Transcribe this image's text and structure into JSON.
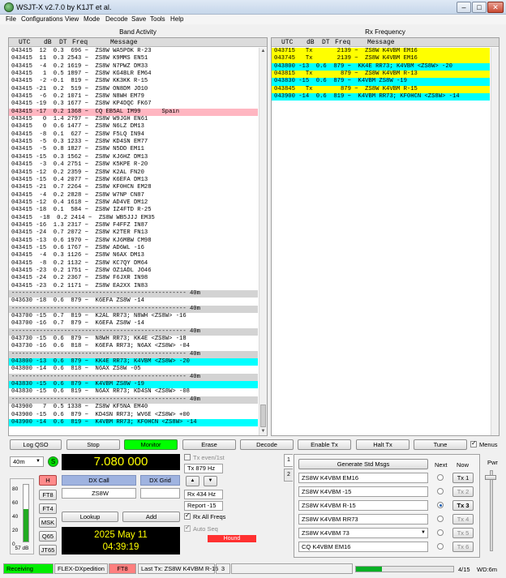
{
  "title": "WSJT-X   v2.7.0   by K1JT et al.",
  "menu": [
    "File",
    "Configurations",
    "View",
    "Mode",
    "Decode",
    "Save",
    "Tools",
    "Help"
  ],
  "band_activity": {
    "title": "Band Activity",
    "headers": [
      "UTC",
      "dB",
      "DT",
      "Freq",
      "Message"
    ],
    "lines": [
      {
        "t": "043415  12  0.3  696 ~  ZS8W WA5POK R-23",
        "c": ""
      },
      {
        "t": "043415  11  0.3 2543 ~  ZS8W K9MMS EN51",
        "c": ""
      },
      {
        "t": "043415  -4  0.2 1619 ~  ZS8W N7PWZ DM33",
        "c": ""
      },
      {
        "t": "043415   1  0.5 1897 ~  ZS8W KG4BLR EM64",
        "c": ""
      },
      {
        "t": "043415  -2 -0.1  819 ~  ZS8W KK3KK R-15",
        "c": ""
      },
      {
        "t": "043415 -21  0.2  519 ~  ZS8W ON8DM JO10",
        "c": ""
      },
      {
        "t": "043415  -6  0.2 1071 ~  ZS8W N8WH EM79",
        "c": ""
      },
      {
        "t": "043415 -19  0.3 1677 ~  ZS8W KP4DQC FK67",
        "c": ""
      },
      {
        "t": "043415 -17  0.2 1368 ~  CQ EB5AL IM99      Spain",
        "c": "pink"
      },
      {
        "t": "043415   0  1.4 2797 ~  ZS8W W9JGH EN61",
        "c": ""
      },
      {
        "t": "043415   0  0.6 1477 ~  ZS8W N6LZ DM13",
        "c": ""
      },
      {
        "t": "043415  -8  0.1  627 ~  ZS8W F5LQ IN94",
        "c": ""
      },
      {
        "t": "043415  -5  0.3 1233 ~  ZS8W KD4SN EM77",
        "c": ""
      },
      {
        "t": "043415  -5  0.8 1827 ~  ZS8W N5DD EM11",
        "c": ""
      },
      {
        "t": "043415 -15  0.3 1562 ~  ZS8W KJ6HZ DM13",
        "c": ""
      },
      {
        "t": "043415  -3  0.4 2751 ~  ZS8W K5KPE R-20",
        "c": ""
      },
      {
        "t": "043415 -12  0.2 2359 ~  ZS8W K2AL FN20",
        "c": ""
      },
      {
        "t": "043415 -15  0.4 2077 ~  ZS8W K6EFA DM13",
        "c": ""
      },
      {
        "t": "043415 -21  0.7 2264 ~  ZS8W KF0HCN EM28",
        "c": ""
      },
      {
        "t": "043415  -4  0.2 2828 ~  ZS8W W7NP CN87",
        "c": ""
      },
      {
        "t": "043415 -12  0.4 1618 ~  ZS8W AD4VE DM12",
        "c": ""
      },
      {
        "t": "043415 -18  0.1  584 ~  ZS8W IZ4FTD R-25",
        "c": ""
      },
      {
        "t": "043415  -18  0.2 2414 ~  ZS8W WB5JJJ EM35",
        "c": ""
      },
      {
        "t": "043415 -16  1.3 2317 ~  ZS8W F4FFZ IN87",
        "c": ""
      },
      {
        "t": "043415 -24  0.7 2072 ~  ZS8W K2TER FN13",
        "c": ""
      },
      {
        "t": "043415 -13  0.6 1970 ~  ZS8W KJ6MBW CM98",
        "c": ""
      },
      {
        "t": "043415 -15  0.6 1767 ~  ZS8W AD6WL -16",
        "c": ""
      },
      {
        "t": "043415  -4  0.3 1126 ~  ZS8W N6AX DM13",
        "c": ""
      },
      {
        "t": "043415  -8  0.2 1132 ~  ZS8W KC7QY DM64",
        "c": ""
      },
      {
        "t": "043415 -23  0.2 1751 ~  ZS8W OZ1ADL JO46",
        "c": ""
      },
      {
        "t": "043415 -24  0.2 2367 ~  ZS8W F6JXR IN98",
        "c": ""
      },
      {
        "t": "043415 -23  0.2 1171 ~  ZS8W EA2XX IN83",
        "c": ""
      },
      {
        "t": "-------------------------------------------------- 40m",
        "c": "sep"
      },
      {
        "t": "043630 -18  0.6  879 ~  K6EFA ZS8W -14",
        "c": ""
      },
      {
        "t": "-------------------------------------------------- 40m",
        "c": "sep"
      },
      {
        "t": "043700 -15  0.7  819 ~  K2AL RR73; N8WH <ZS8W> -16",
        "c": ""
      },
      {
        "t": "043700 -16  0.7  879 ~  K6EFA ZS8W -14",
        "c": ""
      },
      {
        "t": "-------------------------------------------------- 40m",
        "c": "sep"
      },
      {
        "t": "043730 -15  0.6  879 ~  N8WH RR73; KK4E <ZS8W> -18",
        "c": ""
      },
      {
        "t": "043730 -16  0.6  818 ~  K6EFA RR73; N6AX <ZS8W> -04",
        "c": ""
      },
      {
        "t": "-------------------------------------------------- 40m",
        "c": "sep"
      },
      {
        "t": "043800 -13  0.6  879 ~  KK4E RR73; K4VBM <ZS8W> -20",
        "c": "cyan"
      },
      {
        "t": "043800 -14  0.6  818 ~  N6AX ZS8W -05",
        "c": ""
      },
      {
        "t": "-------------------------------------------------- 40m",
        "c": "sep"
      },
      {
        "t": "043830 -15  0.6  879 ~  K4VBM ZS8W -19",
        "c": "cyan"
      },
      {
        "t": "043830 -15  0.6  819 ~  N6AX RR73; KD4SN <ZS8W> -08",
        "c": ""
      },
      {
        "t": "-------------------------------------------------- 40m",
        "c": "sep"
      },
      {
        "t": "043900   7  0.5 1338 ~  ZS8W KF5NA EM40",
        "c": ""
      },
      {
        "t": "043900 -15  0.6  879 ~  KD4SN RR73; WV6E <ZS8W> +00",
        "c": ""
      },
      {
        "t": "043900 -14  0.6  819 ~  K4VBM RR73; KF0HCN <ZS8W> -14",
        "c": "cyan"
      }
    ]
  },
  "rx_frequency": {
    "title": "Rx Frequency",
    "headers": [
      "UTC",
      "dB",
      "DT",
      "Freq",
      "Message"
    ],
    "lines": [
      {
        "t": "043715   Tx       2139 ~  ZS8W K4VBM EM16",
        "c": "yellow"
      },
      {
        "t": "043745   Tx       2139 ~  ZS8W K4VBM EM16",
        "c": "yellow"
      },
      {
        "t": "043800 -13  0.6  879 ~  KK4E RR73; K4VBM <ZS8W> -20",
        "c": "cyan"
      },
      {
        "t": "043815   Tx        879 ~  ZS8W K4VBM R-13",
        "c": "yellow"
      },
      {
        "t": "043830 -15  0.6  879 ~  K4VBM ZS8W -19",
        "c": "cyan"
      },
      {
        "t": "043845   Tx        879 ~  ZS8W K4VBM R-15",
        "c": "yellow"
      },
      {
        "t": "043900 -14  0.6  819 ~  K4VBM RR73; KF0HCN <ZS8W> -14",
        "c": "cyan"
      }
    ]
  },
  "buttons": {
    "log_qso": "Log QSO",
    "stop": "Stop",
    "monitor": "Monitor",
    "erase": "Erase",
    "decode": "Decode",
    "enable_tx": "Enable Tx",
    "halt_tx": "Halt Tx",
    "tune": "Tune",
    "menus": "Menus"
  },
  "band": "40m",
  "s_indicator": "S",
  "frequency": "7.080 000",
  "tx_even": "Tx even/1st",
  "dx_call_label": "DX Call",
  "dx_grid_label": "DX Grid",
  "dx_call": "ZS8W",
  "dx_grid": "",
  "tx_hz": "Tx  879  Hz",
  "rx_hz": "Rx  434  Hz",
  "report": "Report -15",
  "lookup": "Lookup",
  "add": "Add",
  "rx_all_freqs": "Rx All Freqs",
  "auto_seq": "Auto Seq",
  "hound": "Hound",
  "date": "2025 May 11",
  "time": "04:39:19",
  "mode_buttons": [
    "H",
    "FT8",
    "FT4",
    "MSK",
    "Q65",
    "JT65"
  ],
  "meter_ticks": [
    "80",
    "60",
    "40",
    "20",
    "0"
  ],
  "meter_db": "57 dB",
  "meter_level_pct": 57,
  "tabs": [
    "1",
    "2"
  ],
  "generate": "Generate Std Msgs",
  "next_label": "Next",
  "now_label": "Now",
  "tx_msgs": [
    {
      "msg": "ZS8W K4VBM EM16",
      "btn": "Tx 1",
      "next": false
    },
    {
      "msg": "ZS8W K4VBM -15",
      "btn": "Tx 2",
      "next": false
    },
    {
      "msg": "ZS8W K4VBM R-15",
      "btn": "Tx 3",
      "next": true
    },
    {
      "msg": "ZS8W K4VBM RR73",
      "btn": "Tx 4",
      "next": false
    },
    {
      "msg": "ZS8W K4VBM 73",
      "btn": "Tx 5",
      "next": false
    },
    {
      "msg": "CQ K4VBM EM16",
      "btn": "Tx 6",
      "next": false
    }
  ],
  "pwr_label": "Pwr",
  "status": {
    "receiving": "Receiving",
    "mode_name": "FLEX-DXpedition",
    "ft8": "FT8",
    "last_tx": "Last Tx: ZS8W K4VBM R-15",
    "count": "3",
    "progress": "4/15",
    "progress_pct": 27,
    "wd": "WD:6m"
  }
}
